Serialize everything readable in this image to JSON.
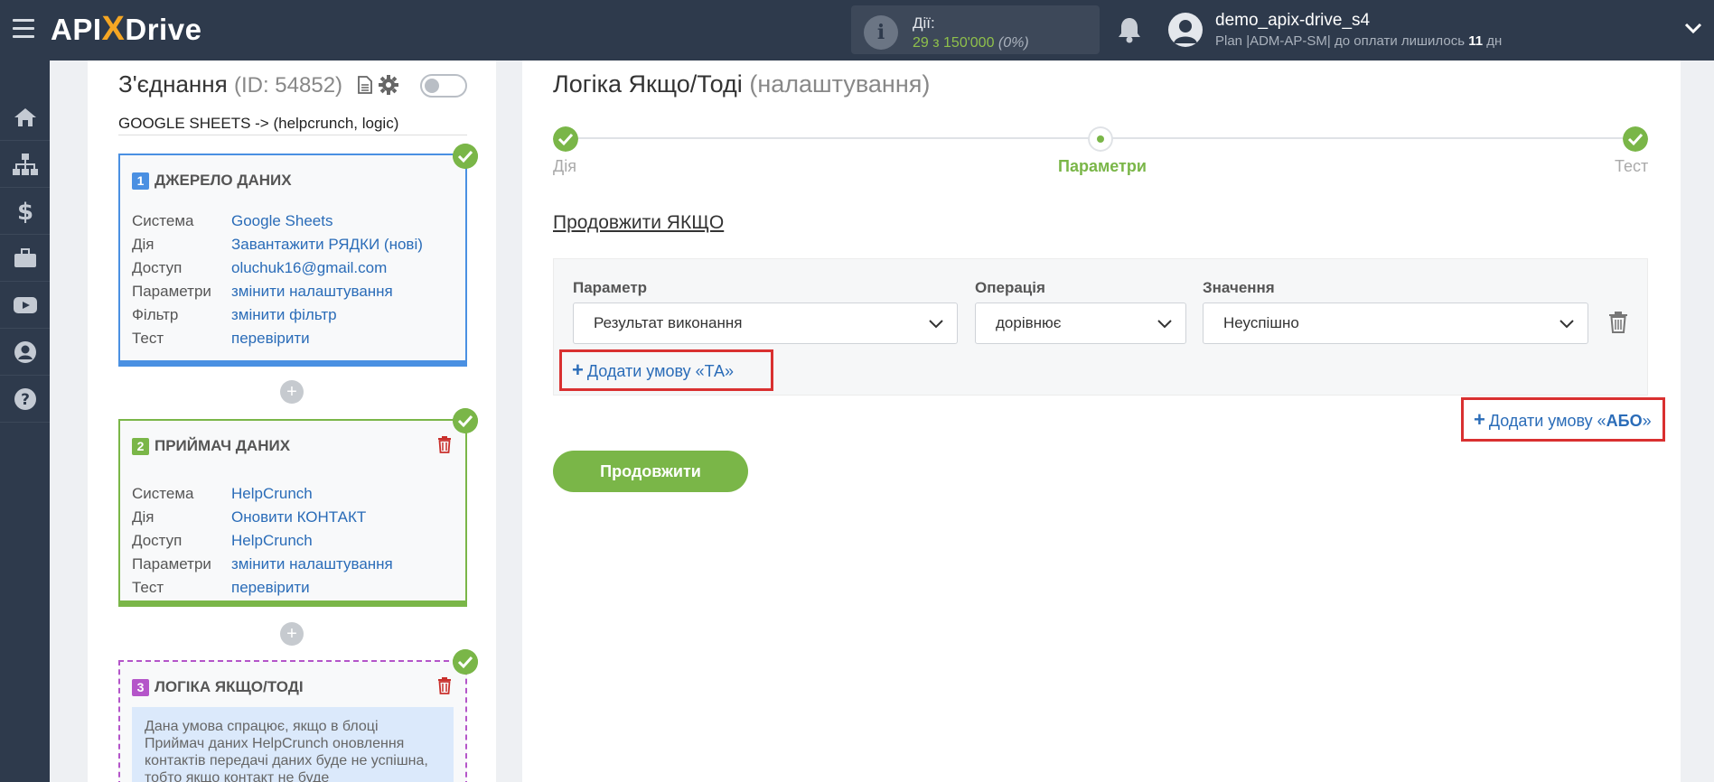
{
  "header": {
    "logo": {
      "part1": "API",
      "x": "X",
      "part2": "Drive"
    },
    "actions": {
      "label": "Дії:",
      "count": "29 з 150'000",
      "percent": "(0%)"
    },
    "user": {
      "name": "demo_apix-drive_s4",
      "plan_prefix": "Plan |ADM-AP-SM| до оплати лишилось ",
      "plan_days": "11",
      "plan_suffix": " дн"
    }
  },
  "sidebar_icons": [
    "home-icon",
    "sitemap-icon",
    "dollar-icon",
    "briefcase-icon",
    "youtube-icon",
    "user-circle-icon",
    "question-icon"
  ],
  "connection": {
    "title": "З'єднання",
    "id_text": "(ID: 54852)",
    "subtitle": "GOOGLE SHEETS -> (helpcrunch, logic)"
  },
  "blocks": [
    {
      "number": "1",
      "title": "ДЖЕРЕЛО ДАНИХ",
      "rows": [
        {
          "key": "Система",
          "value": "Google Sheets"
        },
        {
          "key": "Дія",
          "value": "Завантажити РЯДКИ (нові)"
        },
        {
          "key": "Доступ",
          "value": "oluchuk16@gmail.com"
        },
        {
          "key": "Параметри",
          "value": "змінити налаштування"
        },
        {
          "key": "Фільтр",
          "value": "змінити фільтр"
        },
        {
          "key": "Тест",
          "value": "перевірити"
        }
      ]
    },
    {
      "number": "2",
      "title": "ПРИЙМАЧ ДАНИХ",
      "rows": [
        {
          "key": "Система",
          "value": "HelpCrunch"
        },
        {
          "key": "Дія",
          "value": "Оновити КОНТАКТ"
        },
        {
          "key": "Доступ",
          "value": "HelpCrunch"
        },
        {
          "key": "Параметри",
          "value": "змінити налаштування"
        },
        {
          "key": "Тест",
          "value": "перевірити"
        }
      ]
    },
    {
      "number": "3",
      "title": "ЛОГІКА ЯКЩО/ТОДІ",
      "note": "Дана умова спрацює, якщо в блоці Приймач даних HelpCrunch оновлення контактів передачі даних буде не успішна, тобто якщо контакт не буде"
    }
  ],
  "main": {
    "title": "Логіка Якщо/Тоді",
    "title_sub": "(налаштування)",
    "steps": [
      {
        "label": "Дія",
        "state": "done"
      },
      {
        "label": "Параметри",
        "state": "current"
      },
      {
        "label": "Тест",
        "state": "done"
      }
    ],
    "section_title": "Продовжити ЯКЩО",
    "condition": {
      "param_label": "Параметр",
      "param_value": "Результат виконання",
      "op_label": "Операція",
      "op_value": "дорівнює",
      "val_label": "Значення",
      "val_value": "Неуспішно"
    },
    "add_and": "Додати умову «ТА»",
    "add_or_prefix": "Додати умову «",
    "add_or_bold": "АБО",
    "add_or_suffix": "»",
    "continue": "Продовжити"
  },
  "colors": {
    "topbar": "#2e3a4c",
    "accent_green": "#7ab648",
    "link_blue": "#2a6cb8",
    "source_blue": "#4a90e2",
    "logic_purple": "#b455c9",
    "highlight_red": "#d93030"
  }
}
